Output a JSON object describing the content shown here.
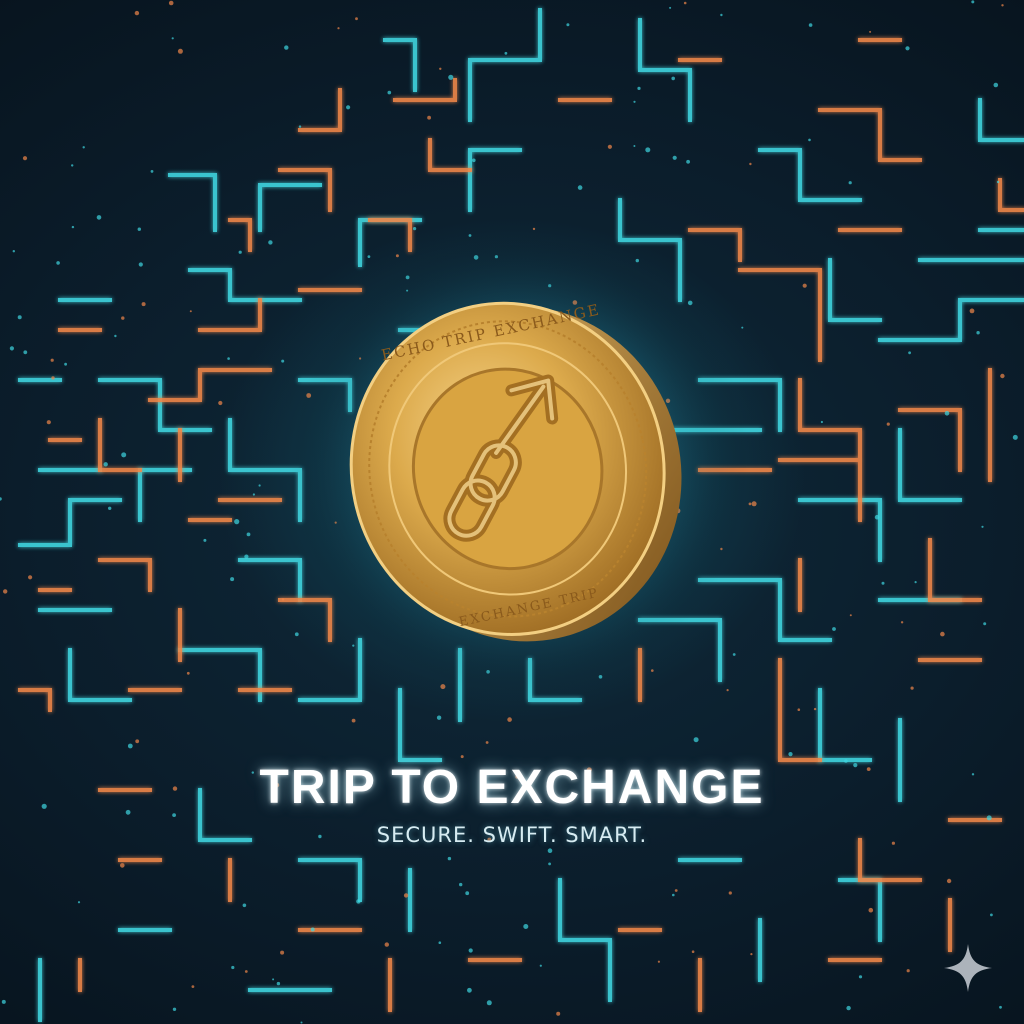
{
  "headline": "TRIP TO EXCHANGE",
  "tagline": "SECURE. SWIFT. SMART.",
  "coin": {
    "rim_text_top": "ECHO TRIP EXCHANGE",
    "rim_text_bottom": "EXCHANGE TRIP",
    "emblem_icon": "chain-link-arrow-icon"
  },
  "corner_icon": "sparkle-icon",
  "colors": {
    "background": "#0b1a26",
    "teal_circuit": "#3fd6e0",
    "orange_circuit": "#f0874a",
    "coin_gold": "#d9a441",
    "text": "#ffffff"
  }
}
